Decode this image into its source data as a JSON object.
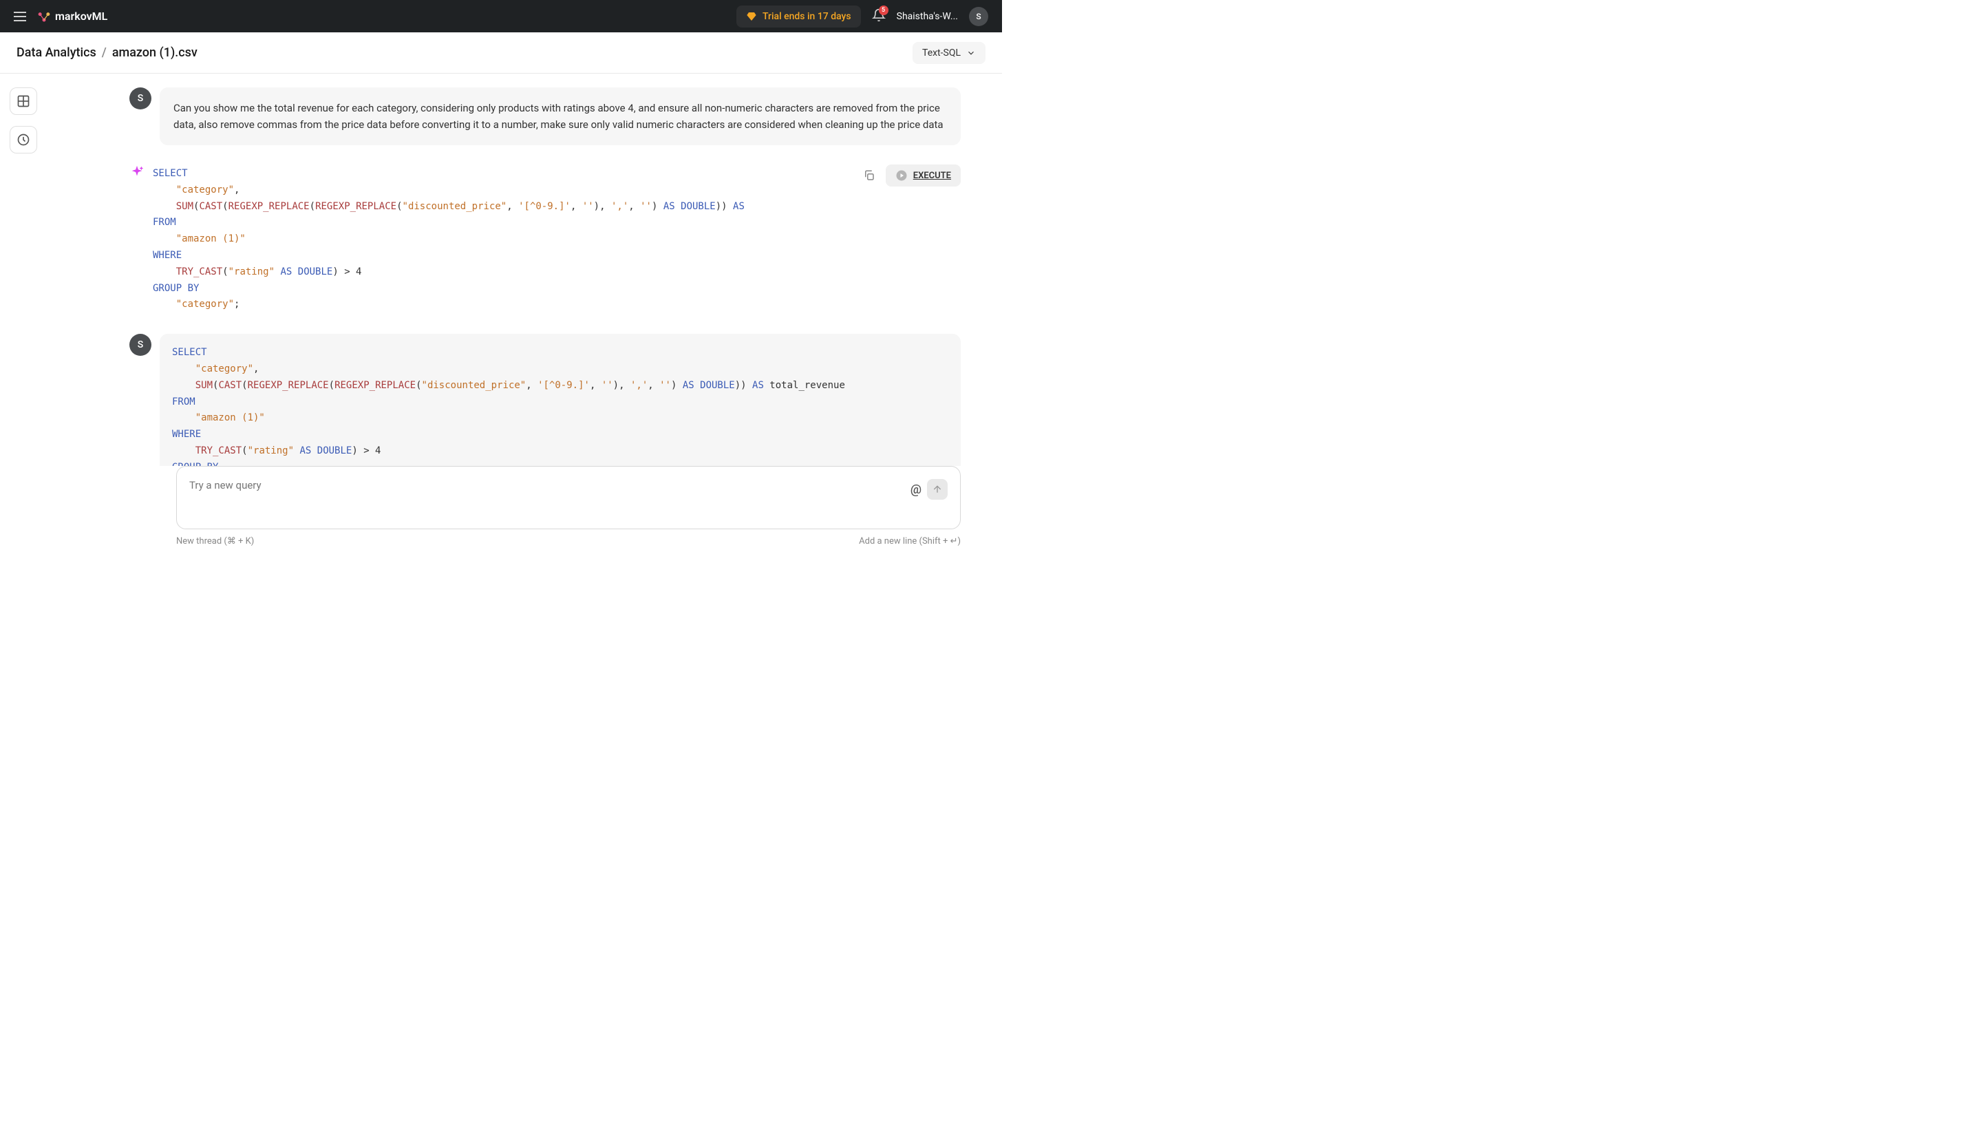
{
  "topbar": {
    "brand": "markovML",
    "trial_text": "Trial ends in 17 days",
    "notification_count": "5",
    "workspace": "Shaistha's-W...",
    "avatar_initial": "S"
  },
  "breadcrumb": {
    "root": "Data Analytics",
    "file": "amazon (1).csv"
  },
  "mode": {
    "label": "Text-SQL"
  },
  "user_avatar_initial": "S",
  "messages": {
    "user1": "Can you show me the total revenue for each category, considering only products with ratings above 4, and ensure all non-numeric characters are removed from the price data, also remove commas from the price data before converting it to a number, make sure only valid numeric characters are considered when cleaning up the price data"
  },
  "sql1": {
    "tokens": [
      {
        "t": "kw",
        "v": "SELECT"
      },
      {
        "t": "nl"
      },
      {
        "t": "pad",
        "v": "    "
      },
      {
        "t": "str",
        "v": "\"category\""
      },
      {
        "t": "sym",
        "v": ","
      },
      {
        "t": "nl"
      },
      {
        "t": "pad",
        "v": "    "
      },
      {
        "t": "fn",
        "v": "SUM"
      },
      {
        "t": "sym",
        "v": "("
      },
      {
        "t": "fn",
        "v": "CAST"
      },
      {
        "t": "sym",
        "v": "("
      },
      {
        "t": "fn",
        "v": "REGEXP_REPLACE"
      },
      {
        "t": "sym",
        "v": "("
      },
      {
        "t": "fn",
        "v": "REGEXP_REPLACE"
      },
      {
        "t": "sym",
        "v": "("
      },
      {
        "t": "str",
        "v": "\"discounted_price\""
      },
      {
        "t": "sym",
        "v": ", "
      },
      {
        "t": "str",
        "v": "'[^0-9.]'"
      },
      {
        "t": "sym",
        "v": ", "
      },
      {
        "t": "str",
        "v": "''"
      },
      {
        "t": "sym",
        "v": "), "
      },
      {
        "t": "str",
        "v": "','"
      },
      {
        "t": "sym",
        "v": ", "
      },
      {
        "t": "str",
        "v": "''"
      },
      {
        "t": "sym",
        "v": ") "
      },
      {
        "t": "kw",
        "v": "AS"
      },
      {
        "t": "sym",
        "v": " "
      },
      {
        "t": "kw",
        "v": "DOUBLE"
      },
      {
        "t": "sym",
        "v": ")) "
      },
      {
        "t": "kw",
        "v": "AS"
      },
      {
        "t": "nl"
      },
      {
        "t": "kw",
        "v": "FROM"
      },
      {
        "t": "nl"
      },
      {
        "t": "pad",
        "v": "    "
      },
      {
        "t": "str",
        "v": "\"amazon (1)\""
      },
      {
        "t": "nl"
      },
      {
        "t": "kw",
        "v": "WHERE"
      },
      {
        "t": "nl"
      },
      {
        "t": "pad",
        "v": "    "
      },
      {
        "t": "fn",
        "v": "TRY_CAST"
      },
      {
        "t": "sym",
        "v": "("
      },
      {
        "t": "str",
        "v": "\"rating\""
      },
      {
        "t": "sym",
        "v": " "
      },
      {
        "t": "kw",
        "v": "AS"
      },
      {
        "t": "sym",
        "v": " "
      },
      {
        "t": "kw",
        "v": "DOUBLE"
      },
      {
        "t": "sym",
        "v": ") > 4"
      },
      {
        "t": "nl"
      },
      {
        "t": "kw",
        "v": "GROUP BY"
      },
      {
        "t": "nl"
      },
      {
        "t": "pad",
        "v": "    "
      },
      {
        "t": "str",
        "v": "\"category\""
      },
      {
        "t": "sym",
        "v": ";"
      }
    ]
  },
  "sql2": {
    "tokens": [
      {
        "t": "kw",
        "v": "SELECT"
      },
      {
        "t": "nl"
      },
      {
        "t": "pad",
        "v": "    "
      },
      {
        "t": "str",
        "v": "\"category\""
      },
      {
        "t": "sym",
        "v": ","
      },
      {
        "t": "nl"
      },
      {
        "t": "pad",
        "v": "    "
      },
      {
        "t": "fn",
        "v": "SUM"
      },
      {
        "t": "sym",
        "v": "("
      },
      {
        "t": "fn",
        "v": "CAST"
      },
      {
        "t": "sym",
        "v": "("
      },
      {
        "t": "fn",
        "v": "REGEXP_REPLACE"
      },
      {
        "t": "sym",
        "v": "("
      },
      {
        "t": "fn",
        "v": "REGEXP_REPLACE"
      },
      {
        "t": "sym",
        "v": "("
      },
      {
        "t": "str",
        "v": "\"discounted_price\""
      },
      {
        "t": "sym",
        "v": ", "
      },
      {
        "t": "str",
        "v": "'[^0-9.]'"
      },
      {
        "t": "sym",
        "v": ", "
      },
      {
        "t": "str",
        "v": "''"
      },
      {
        "t": "sym",
        "v": "), "
      },
      {
        "t": "str",
        "v": "','"
      },
      {
        "t": "sym",
        "v": ", "
      },
      {
        "t": "str",
        "v": "''"
      },
      {
        "t": "sym",
        "v": ") "
      },
      {
        "t": "kw",
        "v": "AS"
      },
      {
        "t": "sym",
        "v": " "
      },
      {
        "t": "kw",
        "v": "DOUBLE"
      },
      {
        "t": "sym",
        "v": ")) "
      },
      {
        "t": "kw",
        "v": "AS"
      },
      {
        "t": "sym",
        "v": " total_revenue"
      },
      {
        "t": "nl"
      },
      {
        "t": "kw",
        "v": "FROM"
      },
      {
        "t": "nl"
      },
      {
        "t": "pad",
        "v": "    "
      },
      {
        "t": "str",
        "v": "\"amazon (1)\""
      },
      {
        "t": "nl"
      },
      {
        "t": "kw",
        "v": "WHERE"
      },
      {
        "t": "nl"
      },
      {
        "t": "pad",
        "v": "    "
      },
      {
        "t": "fn",
        "v": "TRY_CAST"
      },
      {
        "t": "sym",
        "v": "("
      },
      {
        "t": "str",
        "v": "\"rating\""
      },
      {
        "t": "sym",
        "v": " "
      },
      {
        "t": "kw",
        "v": "AS"
      },
      {
        "t": "sym",
        "v": " "
      },
      {
        "t": "kw",
        "v": "DOUBLE"
      },
      {
        "t": "sym",
        "v": ") > 4"
      },
      {
        "t": "nl"
      },
      {
        "t": "kw",
        "v": "GROUP BY"
      }
    ]
  },
  "execute_label": "EXECUTE",
  "input": {
    "placeholder": "Try a new query"
  },
  "hints": {
    "left": "New thread (⌘ + K)",
    "right": "Add a new line (Shift + ↵)"
  }
}
